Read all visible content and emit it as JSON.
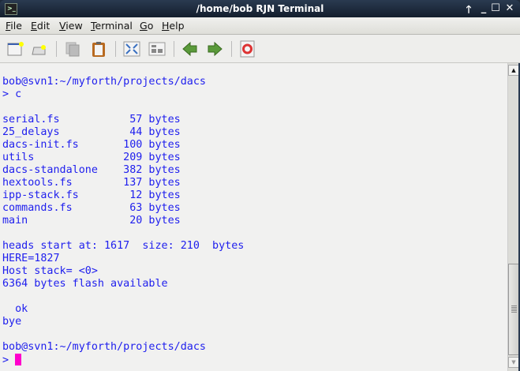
{
  "window": {
    "title": "/home/bob RJN Terminal",
    "buttons": {
      "shade": "🡑",
      "minimize": "_",
      "maximize": "☐",
      "close": "✕"
    }
  },
  "menu": [
    {
      "key": "F",
      "rest": "ile"
    },
    {
      "key": "E",
      "rest": "dit"
    },
    {
      "key": "V",
      "rest": "iew"
    },
    {
      "key": "T",
      "rest": "erminal"
    },
    {
      "key": "G",
      "rest": "o"
    },
    {
      "key": "H",
      "rest": "elp"
    }
  ],
  "toolbar": [
    "new-window",
    "new-tab",
    "copy",
    "paste",
    "fullscreen",
    "tile",
    "back",
    "forward",
    "help"
  ],
  "terminal": {
    "lines": [
      "",
      "bob@svn1:~/myforth/projects/dacs",
      "> c",
      "",
      "serial.fs           57 bytes",
      "25_delays           44 bytes",
      "dacs-init.fs       100 bytes",
      "utils              209 bytes",
      "dacs-standalone    382 bytes",
      "hextools.fs        137 bytes",
      "ipp-stack.fs        12 bytes",
      "commands.fs         63 bytes",
      "main                20 bytes",
      "",
      "heads start at: 1617  size: 210  bytes",
      "HERE=1827",
      "Host stack= <0>",
      "6364 bytes flash available",
      "",
      "  ok",
      "bye",
      "",
      "bob@svn1:~/myforth/projects/dacs"
    ],
    "prompt": "> "
  },
  "colors": {
    "text": "#2020ee",
    "cursor": "#ff00cc"
  }
}
